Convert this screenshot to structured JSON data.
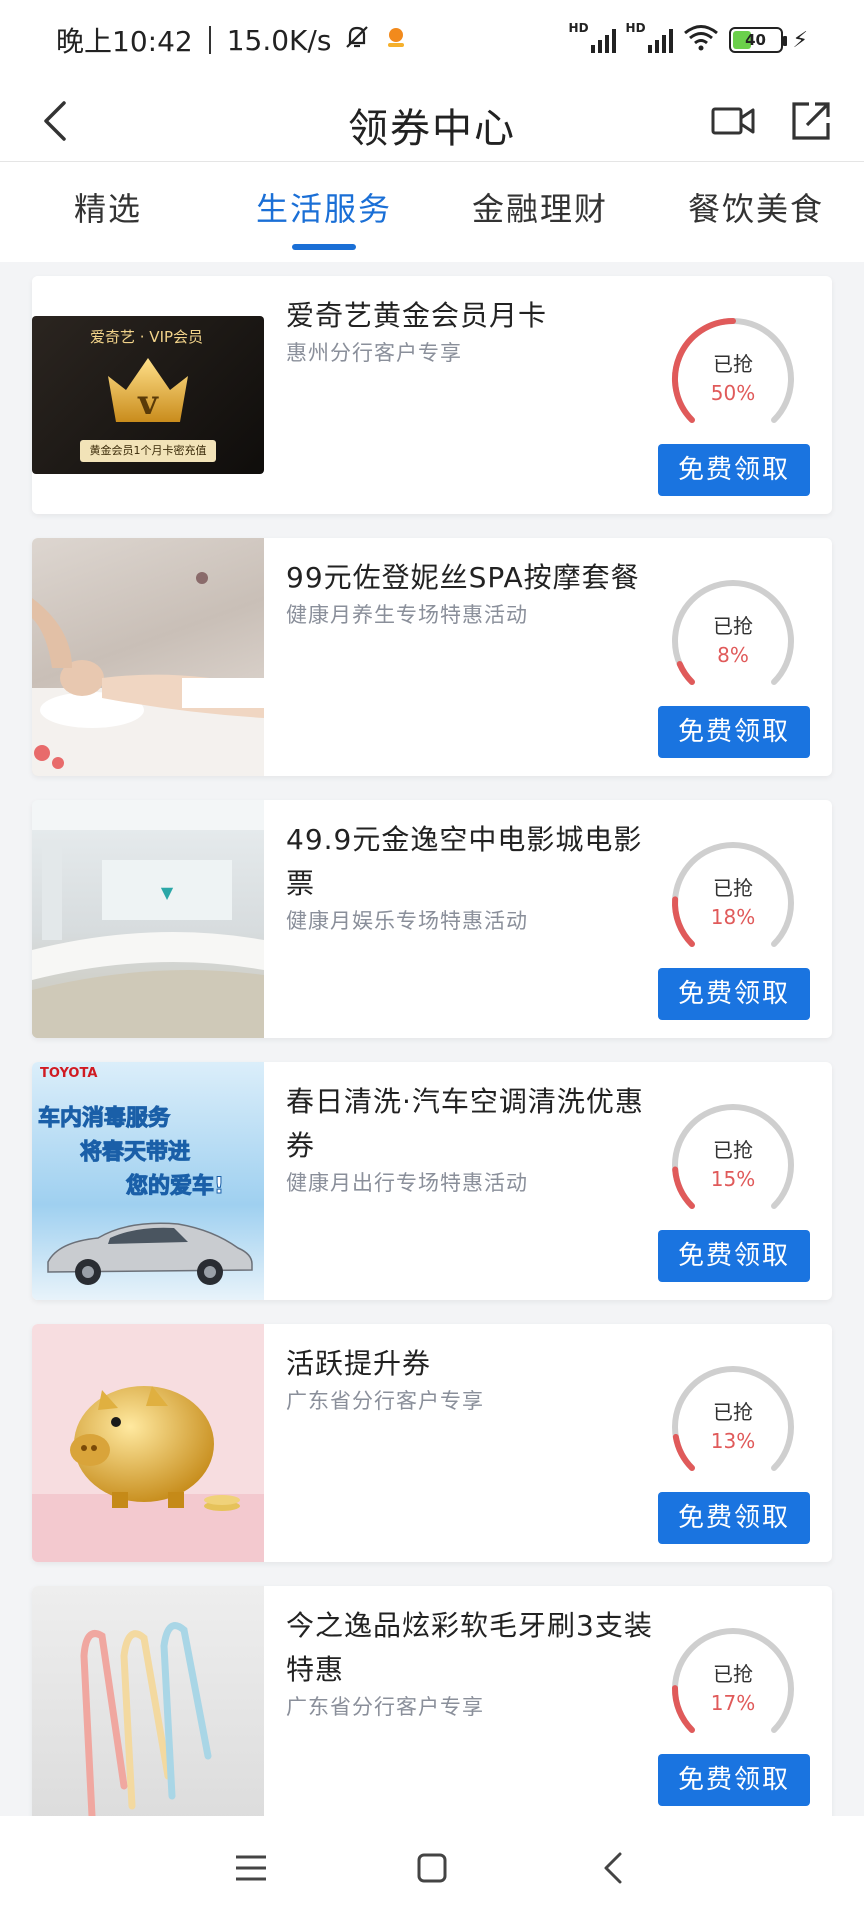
{
  "status": {
    "time": "晚上10:42",
    "speed": "15.0K/s",
    "hd1": "HD",
    "hd2": "HD",
    "battery": "40",
    "battery_level": 0.4
  },
  "header": {
    "title": "领券中心",
    "back_icon": "chevron-left-icon",
    "video_icon": "video-icon",
    "share_icon": "share-icon"
  },
  "tabs": [
    {
      "label": "精选",
      "active": false
    },
    {
      "label": "生活服务",
      "active": true
    },
    {
      "label": "金融理财",
      "active": false
    },
    {
      "label": "餐饮美食",
      "active": false
    }
  ],
  "items": [
    {
      "title": "爱奇艺黄金会员月卡",
      "subtitle": "惠州分行客户专享",
      "grabbed_label": "已抢",
      "percent": "50%",
      "button": "免费领取",
      "thumb_text": {
        "brand": "爱奇艺 · VIP会员",
        "caption": "黄金会员1个月卡密充值"
      }
    },
    {
      "title": "99元佐登妮丝SPA按摩套餐",
      "subtitle": "健康月养生专场特惠活动",
      "grabbed_label": "已抢",
      "percent": "8%",
      "button": "免费领取"
    },
    {
      "title": "49.9元金逸空中电影城电影票",
      "subtitle": "健康月娱乐专场特惠活动",
      "grabbed_label": "已抢",
      "percent": "18%",
      "button": "免费领取"
    },
    {
      "title": "春日清洗·汽车空调清洗优惠券",
      "subtitle": "健康月出行专场特惠活动",
      "grabbed_label": "已抢",
      "percent": "15%",
      "button": "免费领取",
      "thumb_text": {
        "brand": "TOYOTA",
        "line1": "车内消毒服务",
        "line2": "将春天带进",
        "line3": "您的爱车!"
      }
    },
    {
      "title": "活跃提升券",
      "subtitle": "广东省分行客户专享",
      "grabbed_label": "已抢",
      "percent": "13%",
      "button": "免费领取"
    },
    {
      "title": "今之逸品炫彩软毛牙刷3支装特惠",
      "subtitle": "广东省分行客户专享",
      "grabbed_label": "已抢",
      "percent": "17%",
      "button": "免费领取"
    }
  ],
  "colors": {
    "accent": "#1a74e0",
    "ring_track": "#cfcfcf",
    "ring_progress": "#e05a5a"
  },
  "navbar": {
    "menu_icon": "menu-icon",
    "home_icon": "home-square-icon",
    "back_icon": "back-triangle-icon"
  }
}
